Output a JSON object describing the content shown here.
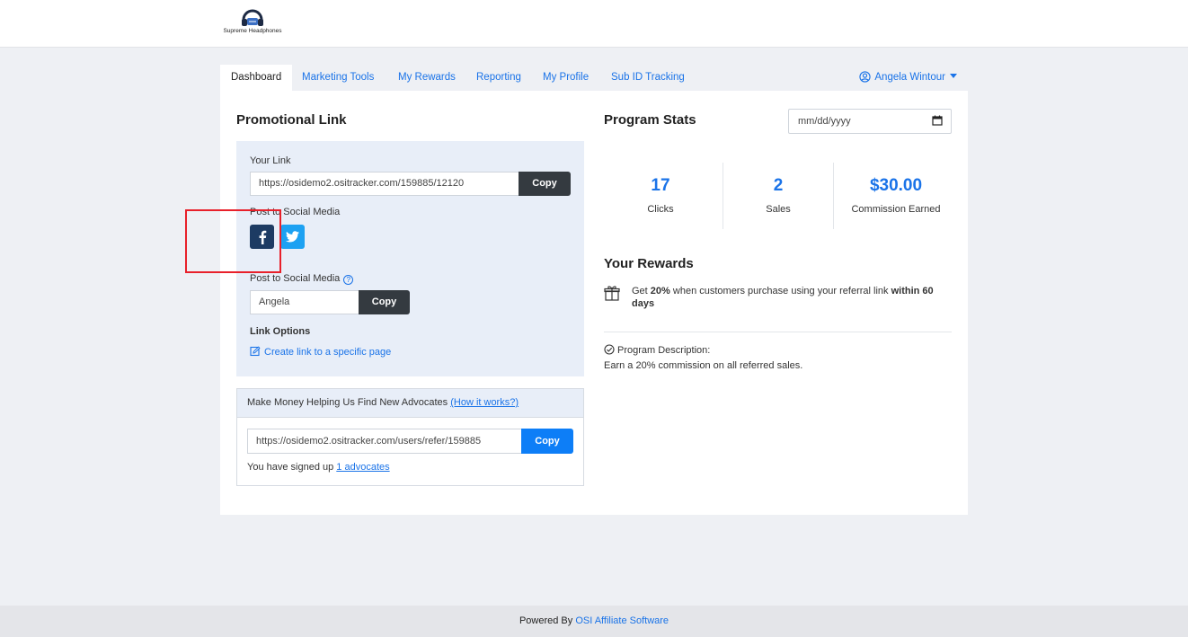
{
  "brand": {
    "logo_text": "Supreme Headphones"
  },
  "nav": {
    "tabs": [
      {
        "label": "Dashboard",
        "active": true
      },
      {
        "label": "Marketing Tools"
      },
      {
        "label": "My Rewards"
      },
      {
        "label": "Reporting"
      },
      {
        "label": "My Profile"
      },
      {
        "label": "Sub ID Tracking"
      }
    ],
    "user_name": "Angela Wintour"
  },
  "promo": {
    "title": "Promotional Link",
    "your_link_label": "Your Link",
    "your_link_value": "https://osidemo2.ositracker.com/159885/12120",
    "copy_label": "Copy",
    "social_label": "Post to Social Media",
    "social_label_2": "Post to Social Media",
    "social_value": "Angela",
    "copy_label_2": "Copy",
    "link_options_label": "Link Options",
    "create_link_label": "Create link to a specific page"
  },
  "advocates": {
    "header_text": "Make Money Helping Us Find New Advocates ",
    "how_it_works": "(How it works?)",
    "refer_link": "https://osidemo2.ositracker.com/users/refer/159885",
    "copy_label": "Copy",
    "signed_prefix": "You have signed up ",
    "signed_link": "1 advocates"
  },
  "stats": {
    "title": "Program Stats",
    "date_placeholder": "mm/dd/yyyy",
    "items": [
      {
        "value": "17",
        "label": "Clicks"
      },
      {
        "value": "2",
        "label": "Sales"
      },
      {
        "value": "$30.00",
        "label": "Commission Earned"
      }
    ]
  },
  "rewards": {
    "title": "Your Rewards",
    "text_1": "Get ",
    "text_bold_1": "20%",
    "text_2": " when customers purchase using your referral link ",
    "text_bold_2": "within 60 days"
  },
  "program": {
    "description_label": "Program Description:",
    "description_text": "Earn a 20% commission on all referred sales."
  },
  "footer": {
    "prefix": "Powered By ",
    "link": "OSI Affiliate Software"
  },
  "colors": {
    "accent": "#1a73e8",
    "dark_button": "#343a40",
    "facebook": "#1d3b63",
    "twitter": "#1da1f2",
    "highlight": "#e8202a"
  }
}
